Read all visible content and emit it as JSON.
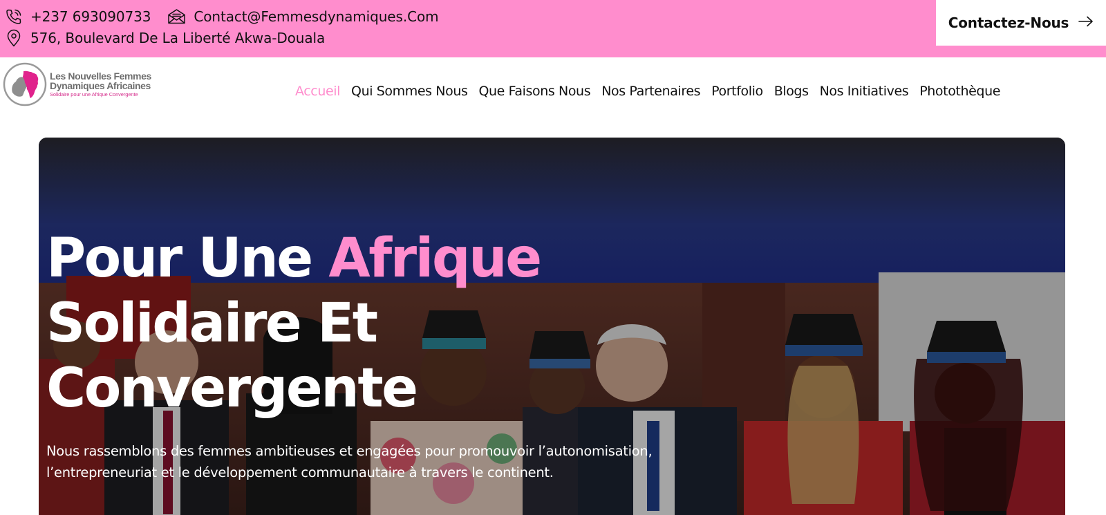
{
  "topbar": {
    "phone": "+237 693090733",
    "email": "Contact@Femmesdynamiques.Com",
    "address": "576, Boulevard De La Liberté Akwa-Douala",
    "contact_button": "Contactez-Nous",
    "background_color": "#ff8dcd"
  },
  "logo": {
    "line1": "Les Nouvelles Femmes",
    "line2": "Dynamiques Africaines",
    "line3": "Solidaire pour une Afrique Convergente"
  },
  "nav": {
    "items": [
      {
        "label": "Accueil",
        "active": true
      },
      {
        "label": "Qui Sommes Nous"
      },
      {
        "label": "Que Faisons Nous"
      },
      {
        "label": "Nos Partenaires"
      },
      {
        "label": "Portfolio"
      },
      {
        "label": "Blogs"
      },
      {
        "label": "Nos Initiatives"
      },
      {
        "label": "Photothèque"
      }
    ],
    "active_color": "#ff8dcd"
  },
  "hero": {
    "title_part1": "Pour Une ",
    "title_highlight": "Afrique",
    "title_line2": "Solidaire Et",
    "title_line3": "Convergente",
    "subtitle": "Nous rassemblons des femmes ambitieuses et engagées pour promouvoir l’autonomisation, l’entrepreneuriat et le développement communautaire à travers le continent."
  },
  "icons": [
    "phone-icon",
    "email-icon",
    "location-icon",
    "arrow-right-icon",
    "logo-africa-mark"
  ]
}
